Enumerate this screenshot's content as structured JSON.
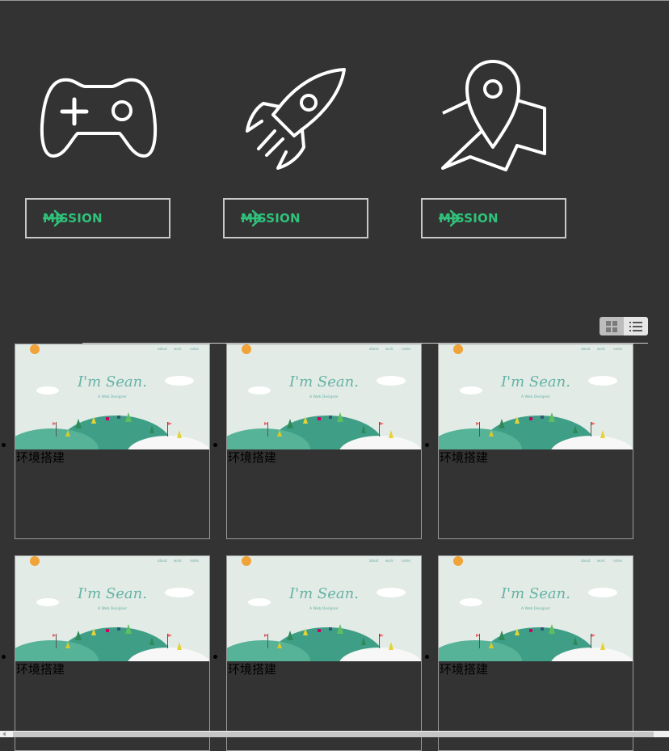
{
  "features": [
    {
      "icon": "gamepad-icon",
      "button_label": "MISSION",
      "arrow_icon": "arrow-right-icon"
    },
    {
      "icon": "rocket-icon",
      "button_label": "MISSION",
      "arrow_icon": "arrow-right-icon"
    },
    {
      "icon": "map-pin-icon",
      "button_label": "MISSION",
      "arrow_icon": "arrow-right-icon"
    }
  ],
  "view_toggle": {
    "grid_icon": "grid-view-icon",
    "list_icon": "list-view-icon"
  },
  "thumbnail": {
    "heading": "I'm Sean.",
    "subheading": "A Web Designer",
    "nav": [
      "about",
      "work",
      "notes"
    ]
  },
  "cards": [
    {
      "title": "环境搭建"
    },
    {
      "title": "环境搭建"
    },
    {
      "title": "环境搭建"
    },
    {
      "title": "环境搭建"
    },
    {
      "title": "环境搭建"
    },
    {
      "title": "环境搭建"
    }
  ],
  "colors": {
    "accent": "#2fc27a",
    "background": "#333333",
    "thumb_bg": "#e2ebe6",
    "hill": "#3f9f86"
  }
}
